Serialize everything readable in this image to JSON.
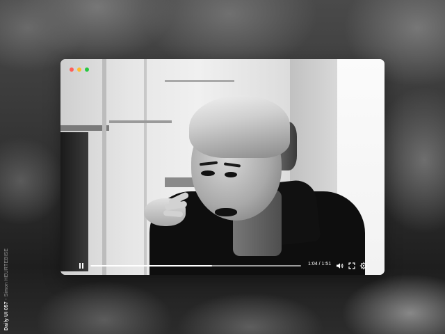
{
  "side_caption": {
    "series": "Daily UI 057",
    "separator": " - ",
    "author": "Simon HEURTEBISE"
  },
  "window_controls": {
    "close_color": "#ff5f57",
    "minimize_color": "#febc2e",
    "maximize_color": "#28c840"
  },
  "player": {
    "time_display": "1:04 / 1:51",
    "progress": 0.577,
    "icons": {
      "play_pause": "pause-icon",
      "volume": "volume-icon",
      "fullscreen": "fullscreen-icon",
      "settings": "settings-icon"
    }
  },
  "colors": {
    "accent": "#ffffff",
    "track": "#9c9c9c"
  }
}
